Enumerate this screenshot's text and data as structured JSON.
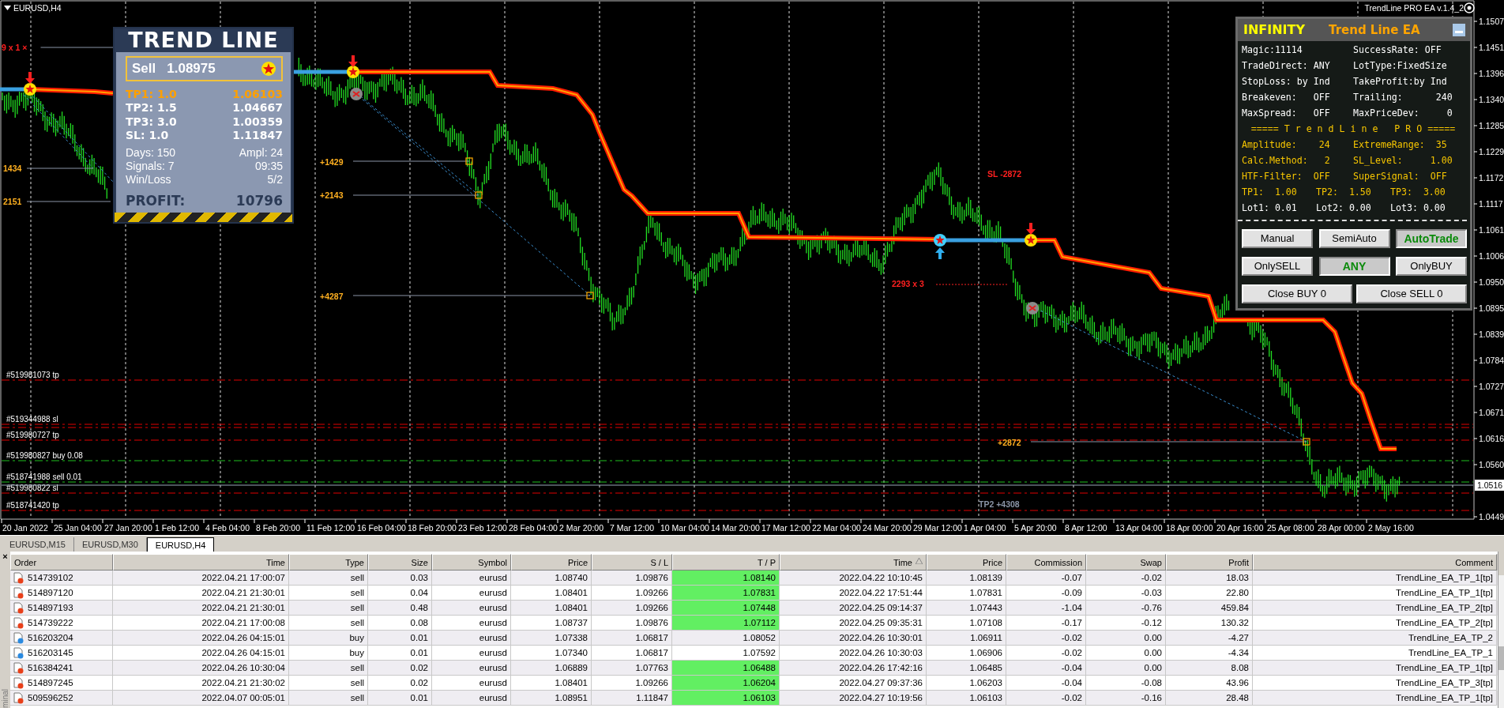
{
  "chart": {
    "symbol": "EURUSD,H4",
    "expert_label": "TrendLine PRO EA v.1.4_2",
    "price_axis": [
      "1.1507",
      "1.1451",
      "1.1396",
      "1.1340",
      "1.1285",
      "1.1229",
      "1.1172",
      "1.1117",
      "1.1061",
      "1.1006",
      "1.0950",
      "1.0895",
      "1.0839",
      "1.0784",
      "1.0727",
      "1.0671",
      "1.0616",
      "1.0560",
      "1.0449"
    ],
    "current_price": "1.0516",
    "time_axis": [
      "20 Jan 2022",
      "25 Jan 04:00",
      "27 Jan 20:00",
      "1 Feb 12:00",
      "4 Feb 04:00",
      "8 Feb 20:00",
      "11 Feb 12:00",
      "16 Feb 04:00",
      "18 Feb 20:00",
      "23 Feb 12:00",
      "28 Feb 04:00",
      "2 Mar 20:00",
      "7 Mar 12:00",
      "10 Mar 04:00",
      "14 Mar 20:00",
      "17 Mar 12:00",
      "22 Mar 04:00",
      "24 Mar 20:00",
      "29 Mar 12:00",
      "1 Apr 04:00",
      "5 Apr 20:00",
      "8 Apr 12:00",
      "13 Apr 04:00",
      "18 Apr 00:00",
      "20 Apr 16:00",
      "25 Apr 08:00",
      "28 Apr 00:00",
      "2 May 16:00"
    ],
    "order_lines": [
      {
        "label": "#519981073 tp",
        "kind": "stop"
      },
      {
        "label": "#519344988 sl",
        "kind": "stop"
      },
      {
        "label": "#519980727 tp",
        "kind": "stop"
      },
      {
        "label": "#519980827 buy 0.08",
        "kind": "open"
      },
      {
        "label": "#518741988 sell 0.01",
        "kind": "open"
      },
      {
        "label": "#519980822 sl",
        "kind": "stop"
      },
      {
        "label": "#518741420 tp",
        "kind": "stop"
      }
    ],
    "profit_labels": [
      {
        "text": "9 x 1 ×",
        "kind": "loss"
      },
      {
        "text": "1434",
        "kind": "gain"
      },
      {
        "text": "2151",
        "kind": "gain"
      },
      {
        "text": "+1429",
        "kind": "gain"
      },
      {
        "text": "+2143",
        "kind": "gain"
      },
      {
        "text": "+4287",
        "kind": "gain"
      },
      {
        "text": "SL -2872",
        "kind": "loss"
      },
      {
        "text": "2293 x 3",
        "kind": "loss"
      },
      {
        "text": "+2872",
        "kind": "gain"
      },
      {
        "text": "TP2 +4308",
        "kind": "target"
      }
    ]
  },
  "trend_panel": {
    "title": "TREND LINE",
    "signal": {
      "side": "Sell",
      "price": "1.08975"
    },
    "targets": [
      {
        "label": "TP1: 1.0",
        "value": "1.06103",
        "hit": true
      },
      {
        "label": "TP2: 1.5",
        "value": "1.04667",
        "hit": false
      },
      {
        "label": "TP3: 3.0",
        "value": "1.00359",
        "hit": false
      },
      {
        "label": "SL: 1.0",
        "value": "1.11847",
        "hit": false
      }
    ],
    "stats": [
      {
        "label": "Days: 150",
        "value": "Ampl: 24"
      },
      {
        "label": "Signals: 7",
        "value": "09:35"
      },
      {
        "label": "Win/Loss",
        "value": "5/2"
      }
    ],
    "profit": {
      "label": "PROFIT:",
      "value": "10796"
    }
  },
  "ea_panel": {
    "title": "INFINITY",
    "subtitle": "Trend Line EA",
    "rows": [
      {
        "kind": "setting",
        "cells": [
          "Magic:11114",
          "SuccessRate: OFF"
        ]
      },
      {
        "kind": "setting",
        "cells": [
          "TradeDirect: ANY",
          "LotType:FixedSize"
        ]
      },
      {
        "kind": "setting",
        "cells": [
          "StopLoss: by Ind",
          "TakeProfit:by Ind"
        ]
      },
      {
        "kind": "setting",
        "cells": [
          "Breakeven:   OFF",
          "Trailing:      240"
        ]
      },
      {
        "kind": "setting",
        "cells": [
          "MaxSpread:   OFF",
          "MaxPriceDev:     0"
        ]
      },
      {
        "kind": "heading",
        "cells": [
          "===== T r e n d L i n e   P R O ====="
        ]
      },
      {
        "kind": "indicator",
        "cells": [
          "Amplitude:    24",
          "ExtremeRange:  35"
        ]
      },
      {
        "kind": "indicator",
        "cells": [
          "Calc.Method:   2",
          "SL_Level:     1.00"
        ]
      },
      {
        "kind": "indicator",
        "cells": [
          "HTF-Filter:  OFF",
          "SuperSignal:  OFF"
        ]
      },
      {
        "kind": "indicator",
        "cells": [
          "TP1:  1.00",
          "TP2:  1.50",
          "TP3:  3.00"
        ]
      },
      {
        "kind": "setting",
        "cells": [
          "Lot1: 0.01",
          "Lot2: 0.00",
          "Lot3: 0.00"
        ]
      }
    ],
    "mode_buttons": [
      {
        "label": "Manual",
        "selected": false
      },
      {
        "label": "SemiAuto",
        "selected": false
      },
      {
        "label": "AutoTrade",
        "selected": true
      }
    ],
    "direction_buttons": [
      {
        "label": "OnlySELL",
        "selected": false
      },
      {
        "label": "ANY",
        "selected": true
      },
      {
        "label": "OnlyBUY",
        "selected": false
      }
    ],
    "close_buttons": [
      "Close BUY 0",
      "Close SELL 0"
    ]
  },
  "tabs": [
    {
      "label": "EURUSD,M15",
      "selected": false
    },
    {
      "label": "EURUSD,M30",
      "selected": false
    },
    {
      "label": "EURUSD,H4",
      "selected": true
    }
  ],
  "terminal": {
    "close": "×",
    "label": "minal",
    "columns": [
      {
        "label": "Order",
        "sorted": false
      },
      {
        "label": "Time",
        "sorted": false
      },
      {
        "label": "Type",
        "sorted": false
      },
      {
        "label": "Size",
        "sorted": false
      },
      {
        "label": "Symbol",
        "sorted": false
      },
      {
        "label": "Price",
        "sorted": false
      },
      {
        "label": "S / L",
        "sorted": false
      },
      {
        "label": "T / P",
        "sorted": false
      },
      {
        "label": "Time",
        "sorted": true
      },
      {
        "label": "Price",
        "sorted": false
      },
      {
        "label": "Commission",
        "sorted": false
      },
      {
        "label": "Swap",
        "sorted": false
      },
      {
        "label": "Profit",
        "sorted": false
      },
      {
        "label": "Comment",
        "sorted": false
      }
    ],
    "rows": [
      {
        "kind": "sell",
        "tp_hit": true,
        "cells": [
          "514739102",
          "2022.04.21 17:00:07",
          "sell",
          "0.03",
          "eurusd",
          "1.08740",
          "1.09876",
          "1.08140",
          "2022.04.22 10:10:45",
          "1.08139",
          "-0.07",
          "-0.02",
          "18.03",
          "TrendLine_EA_TP_1[tp]"
        ]
      },
      {
        "kind": "sell",
        "tp_hit": true,
        "cells": [
          "514897120",
          "2022.04.21 21:30:01",
          "sell",
          "0.04",
          "eurusd",
          "1.08401",
          "1.09266",
          "1.07831",
          "2022.04.22 17:51:44",
          "1.07831",
          "-0.09",
          "-0.03",
          "22.80",
          "TrendLine_EA_TP_1[tp]"
        ]
      },
      {
        "kind": "sell",
        "tp_hit": true,
        "cells": [
          "514897193",
          "2022.04.21 21:30:01",
          "sell",
          "0.48",
          "eurusd",
          "1.08401",
          "1.09266",
          "1.07448",
          "2022.04.25 09:14:37",
          "1.07443",
          "-1.04",
          "-0.76",
          "459.84",
          "TrendLine_EA_TP_2[tp]"
        ]
      },
      {
        "kind": "sell",
        "tp_hit": true,
        "cells": [
          "514739222",
          "2022.04.21 17:00:08",
          "sell",
          "0.08",
          "eurusd",
          "1.08737",
          "1.09876",
          "1.07112",
          "2022.04.25 09:35:31",
          "1.07108",
          "-0.17",
          "-0.12",
          "130.32",
          "TrendLine_EA_TP_2[tp]"
        ]
      },
      {
        "kind": "buy",
        "tp_hit": false,
        "cells": [
          "516203204",
          "2022.04.26 04:15:01",
          "buy",
          "0.01",
          "eurusd",
          "1.07338",
          "1.06817",
          "1.08052",
          "2022.04.26 10:30:01",
          "1.06911",
          "-0.02",
          "0.00",
          "-4.27",
          "TrendLine_EA_TP_2"
        ]
      },
      {
        "kind": "buy",
        "tp_hit": false,
        "cells": [
          "516203145",
          "2022.04.26 04:15:01",
          "buy",
          "0.01",
          "eurusd",
          "1.07340",
          "1.06817",
          "1.07592",
          "2022.04.26 10:30:03",
          "1.06906",
          "-0.02",
          "0.00",
          "-4.34",
          "TrendLine_EA_TP_1"
        ]
      },
      {
        "kind": "sell",
        "tp_hit": true,
        "cells": [
          "516384241",
          "2022.04.26 10:30:04",
          "sell",
          "0.02",
          "eurusd",
          "1.06889",
          "1.07763",
          "1.06488",
          "2022.04.26 17:42:16",
          "1.06485",
          "-0.04",
          "0.00",
          "8.08",
          "TrendLine_EA_TP_1[tp]"
        ]
      },
      {
        "kind": "sell",
        "tp_hit": true,
        "cells": [
          "514897245",
          "2022.04.21 21:30:02",
          "sell",
          "0.02",
          "eurusd",
          "1.08401",
          "1.09266",
          "1.06204",
          "2022.04.27 09:37:36",
          "1.06203",
          "-0.04",
          "-0.08",
          "43.96",
          "TrendLine_EA_TP_3[tp]"
        ]
      },
      {
        "kind": "sell",
        "tp_hit": true,
        "cells": [
          "509596252",
          "2022.04.07 00:05:01",
          "sell",
          "0.01",
          "eurusd",
          "1.08951",
          "1.11847",
          "1.06103",
          "2022.04.27 10:19:56",
          "1.06103",
          "-0.02",
          "-0.16",
          "28.48",
          "TrendLine_EA_TP_1[tp]"
        ]
      }
    ]
  }
}
